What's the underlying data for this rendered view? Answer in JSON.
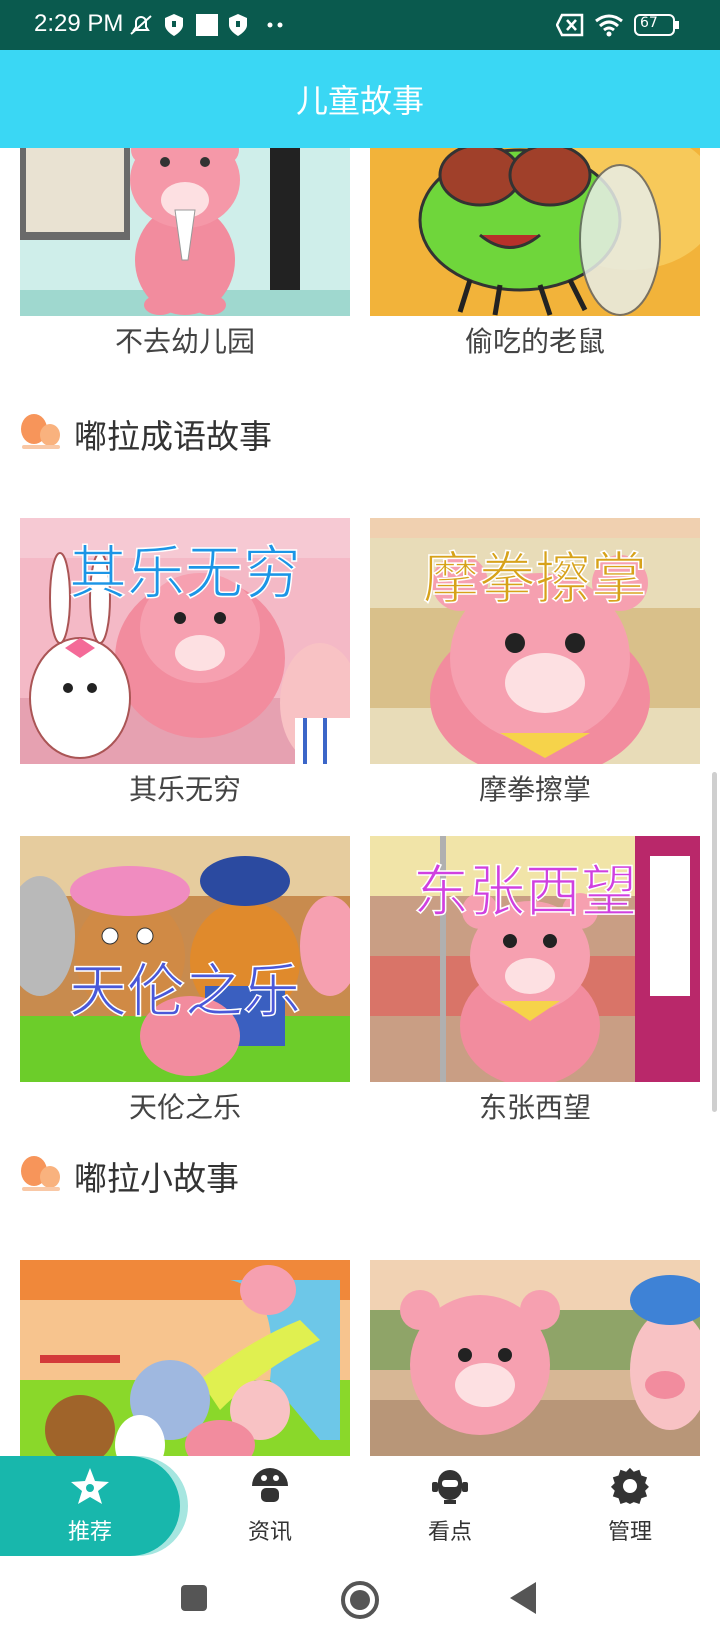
{
  "status": {
    "time": "2:29 PM",
    "battery": "67",
    "icons": [
      "mute-bell-icon",
      "shield-icon",
      "square-icon",
      "shield-icon",
      "dots-icon",
      "sim-x-icon",
      "wifi-icon",
      "battery-icon"
    ]
  },
  "appbar": {
    "title": "儿童故事"
  },
  "top_row": {
    "items": [
      {
        "title": "不去幼儿园"
      },
      {
        "title": "偷吃的老鼠"
      }
    ]
  },
  "sections": [
    {
      "title": "嘟拉成语故事",
      "items": [
        {
          "title": "其乐无穷",
          "overlay": "其乐无穷"
        },
        {
          "title": "摩拳擦掌",
          "overlay": "摩拳擦掌"
        },
        {
          "title": "天伦之乐",
          "overlay": "天伦之乐"
        },
        {
          "title": "东张西望",
          "overlay": "东张西望"
        }
      ]
    },
    {
      "title": "嘟拉小故事",
      "items": [
        {
          "title": ""
        },
        {
          "title": ""
        }
      ]
    }
  ],
  "bottom_nav": {
    "items": [
      {
        "label": "推荐",
        "icon": "star-icon",
        "active": true
      },
      {
        "label": "资讯",
        "icon": "mushroom-icon",
        "active": false
      },
      {
        "label": "看点",
        "icon": "robot-icon",
        "active": false
      },
      {
        "label": "管理",
        "icon": "gear-icon",
        "active": false
      }
    ]
  },
  "colors": {
    "appbar": "#3ad7f4",
    "status": "#0a5a4e",
    "accent": "#18b7ac"
  }
}
